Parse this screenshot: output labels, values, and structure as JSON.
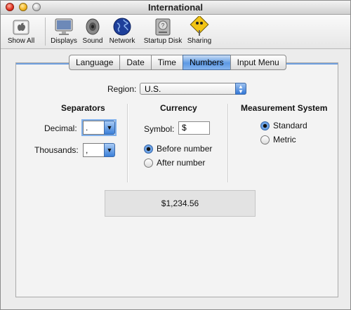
{
  "window": {
    "title": "International"
  },
  "toolbar": {
    "items": [
      {
        "label": "Show All",
        "icon": "apple-prefs-icon"
      },
      {
        "label": "Displays",
        "icon": "display-icon"
      },
      {
        "label": "Sound",
        "icon": "speaker-icon"
      },
      {
        "label": "Network",
        "icon": "globe-icon"
      },
      {
        "label": "Startup Disk",
        "icon": "hard-disk-icon"
      },
      {
        "label": "Sharing",
        "icon": "sharing-sign-icon"
      }
    ]
  },
  "tabs": [
    {
      "label": "Language",
      "active": false
    },
    {
      "label": "Date",
      "active": false
    },
    {
      "label": "Time",
      "active": false
    },
    {
      "label": "Numbers",
      "active": true
    },
    {
      "label": "Input Menu",
      "active": false
    }
  ],
  "region": {
    "label": "Region:",
    "value": "U.S."
  },
  "separators": {
    "heading": "Separators",
    "decimal_label": "Decimal:",
    "decimal_value": ".",
    "thousands_label": "Thousands:",
    "thousands_value": ","
  },
  "currency": {
    "heading": "Currency",
    "symbol_label": "Symbol:",
    "symbol_value": "$",
    "before_label": "Before number",
    "after_label": "After number",
    "selected": "Before number"
  },
  "measurement": {
    "heading": "Measurement System",
    "standard_label": "Standard",
    "metric_label": "Metric",
    "selected": "Standard"
  },
  "sample": {
    "text": "$1,234.56"
  },
  "colors": {
    "accent": "#3b7fd8",
    "tab_active": "#5d9ae4"
  }
}
